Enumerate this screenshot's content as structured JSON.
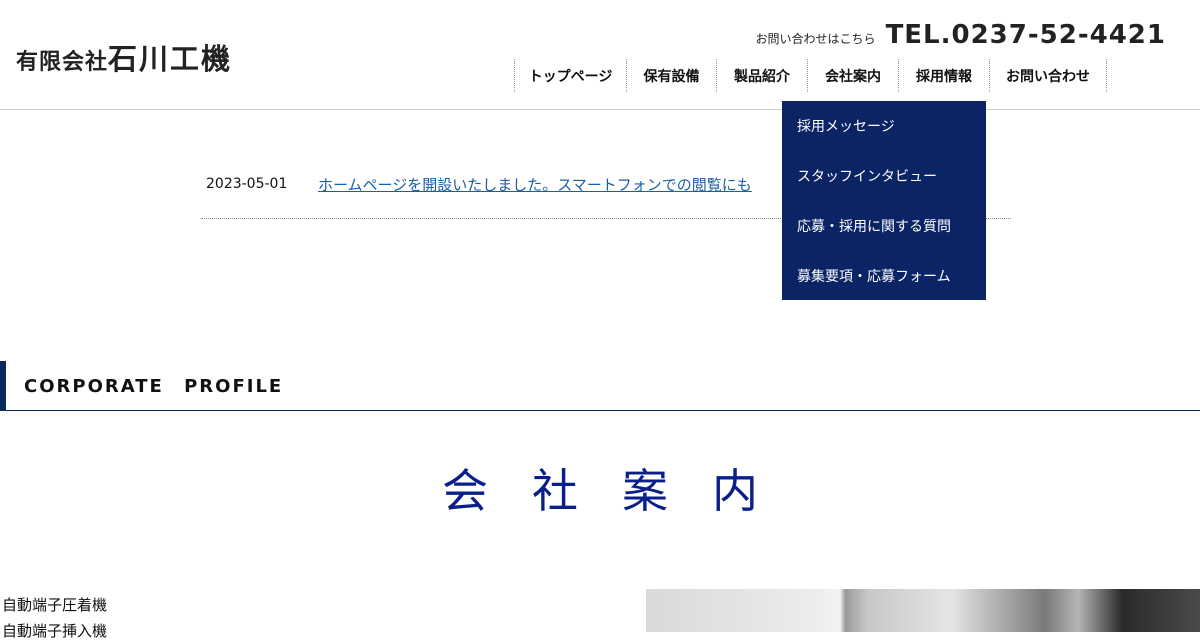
{
  "header": {
    "logo_small": "有限会社",
    "logo_big": "石川工機",
    "contact_label": "お問い合わせはこちら",
    "tel": "TEL.0237-52-4421"
  },
  "nav": {
    "items": [
      {
        "label": "トップページ",
        "width": 111
      },
      {
        "label": "保有設備",
        "width": 90
      },
      {
        "label": "製品紹介",
        "width": 90
      },
      {
        "label": "会社案内",
        "width": 90
      },
      {
        "label": "採用情報",
        "width": 90
      },
      {
        "label": "お問い合わせ",
        "width": 117
      }
    ]
  },
  "dropdown": {
    "items": [
      "採用メッセージ",
      "スタッフインタビュー",
      "応募・採用に関する質問",
      "募集要項・応募フォーム"
    ]
  },
  "news": {
    "date": "2023-05-01",
    "text": "ホームページを開設いたしました。スマートフォンでの閲覧にも"
  },
  "profile": {
    "heading_en": "CORPORATE PROFILE",
    "title": "会社案内",
    "products": [
      "自動端子圧着機",
      "自動端子挿入機"
    ]
  }
}
